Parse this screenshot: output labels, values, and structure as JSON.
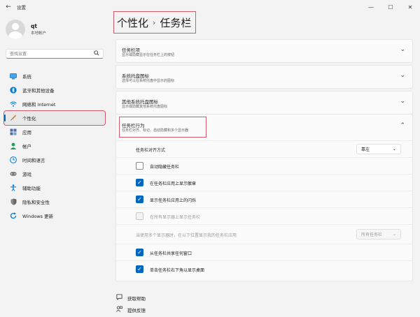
{
  "titlebar": {
    "title": "设置",
    "back": "←",
    "min": "—",
    "max": "☐",
    "close": "✕"
  },
  "profile": {
    "name": "qt",
    "type": "本地帐户"
  },
  "search": {
    "placeholder": "查找设置",
    "icon": "search-icon"
  },
  "nav": [
    {
      "label": "系统",
      "icon": "monitor-icon",
      "color": "#0078d4"
    },
    {
      "label": "蓝牙和其他设备",
      "icon": "bluetooth-icon",
      "color": "#0078d4"
    },
    {
      "label": "网络和 Internet",
      "icon": "wifi-icon",
      "color": "#0078d4"
    },
    {
      "label": "个性化",
      "icon": "brush-icon",
      "color": "#c47b1b",
      "active": true
    },
    {
      "label": "应用",
      "icon": "apps-icon",
      "color": "#4a6fa5"
    },
    {
      "label": "帐户",
      "icon": "person-icon",
      "color": "#1f9d55"
    },
    {
      "label": "时间和语言",
      "icon": "globe-clock-icon",
      "color": "#0078d4"
    },
    {
      "label": "游戏",
      "icon": "gamepad-icon",
      "color": "#777777"
    },
    {
      "label": "辅助功能",
      "icon": "accessibility-icon",
      "color": "#0078d4"
    },
    {
      "label": "隐私和安全性",
      "icon": "shield-icon",
      "color": "#777777"
    },
    {
      "label": "Windows 更新",
      "icon": "update-icon",
      "color": "#0078d4"
    }
  ],
  "header": {
    "parent": "个性化",
    "separator": "›",
    "current": "任务栏"
  },
  "cards": [
    {
      "title": "任务栏项",
      "desc": "显示或隐藏显示在任务栏上的按钮"
    },
    {
      "title": "系统托盘图标",
      "desc": "选择可以在系统托盘中显示的图标"
    },
    {
      "title": "其他系统托盘图标",
      "desc": "显示或隐藏其他系统托盘图标"
    }
  ],
  "behaviors": {
    "title": "任务栏行为",
    "desc": "任务栏对齐、标记、自动隐藏和多个显示器",
    "alignment": {
      "label": "任务栏对齐方式",
      "value": "靠左"
    },
    "checks": [
      {
        "label": "自动隐藏任务栏",
        "checked": false,
        "disabled": false
      },
      {
        "label": "在任务栏应用上显示徽章",
        "checked": true,
        "disabled": false
      },
      {
        "label": "显示任务栏应用上的闪烁",
        "checked": true,
        "disabled": false
      },
      {
        "label": "在所有显示器上显示任务栏",
        "checked": false,
        "disabled": true
      }
    ],
    "multi": {
      "label": "当使用多个显示器时，在以下位置显示我的任务栏应用",
      "value": "所有任务栏"
    },
    "checks2": [
      {
        "label": "从任务栏共享任何窗口",
        "checked": true
      },
      {
        "label": "单击任务栏右下角以显示桌面",
        "checked": true
      }
    ]
  },
  "footer": [
    {
      "label": "获取帮助",
      "icon": "help-icon"
    },
    {
      "label": "提供反馈",
      "icon": "feedback-icon"
    }
  ]
}
